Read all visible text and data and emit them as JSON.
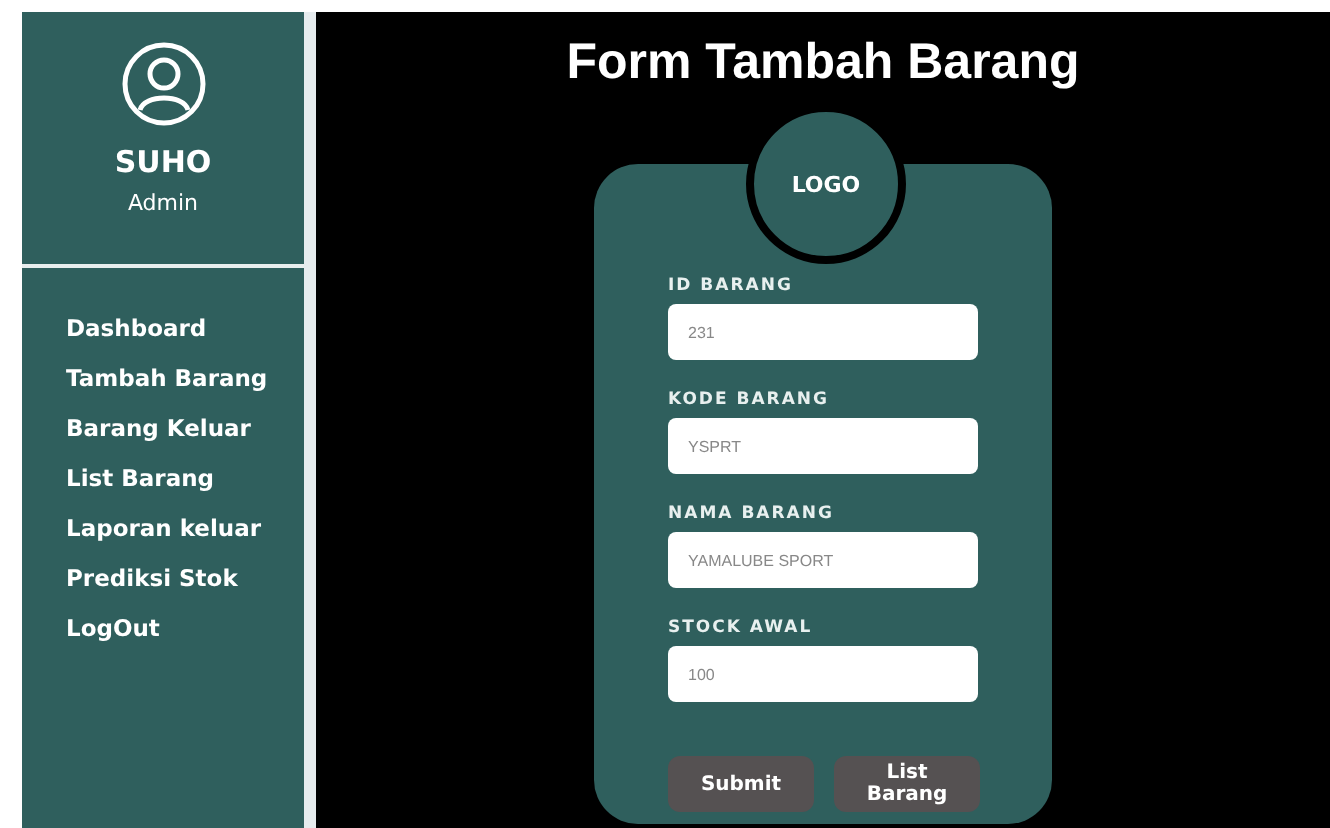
{
  "sidebar": {
    "user_name": "SUHO",
    "role": "Admin",
    "items": [
      {
        "label": "Dashboard"
      },
      {
        "label": "Tambah Barang"
      },
      {
        "label": "Barang Keluar"
      },
      {
        "label": "List Barang"
      },
      {
        "label": "Laporan  keluar"
      },
      {
        "label": "Prediksi Stok"
      },
      {
        "label": "LogOut"
      }
    ]
  },
  "page_title": "Form Tambah Barang",
  "form": {
    "logo": "LOGO",
    "fields": [
      {
        "label": "ID BARANG",
        "placeholder": "231"
      },
      {
        "label": "KODE BARANG",
        "placeholder": "YSPRT"
      },
      {
        "label": "NAMA BARANG",
        "placeholder": "YAMALUBE SPORT"
      },
      {
        "label": "STOCK AWAL",
        "placeholder": "100"
      }
    ],
    "buttons": [
      "Submit",
      "List Barang"
    ]
  }
}
